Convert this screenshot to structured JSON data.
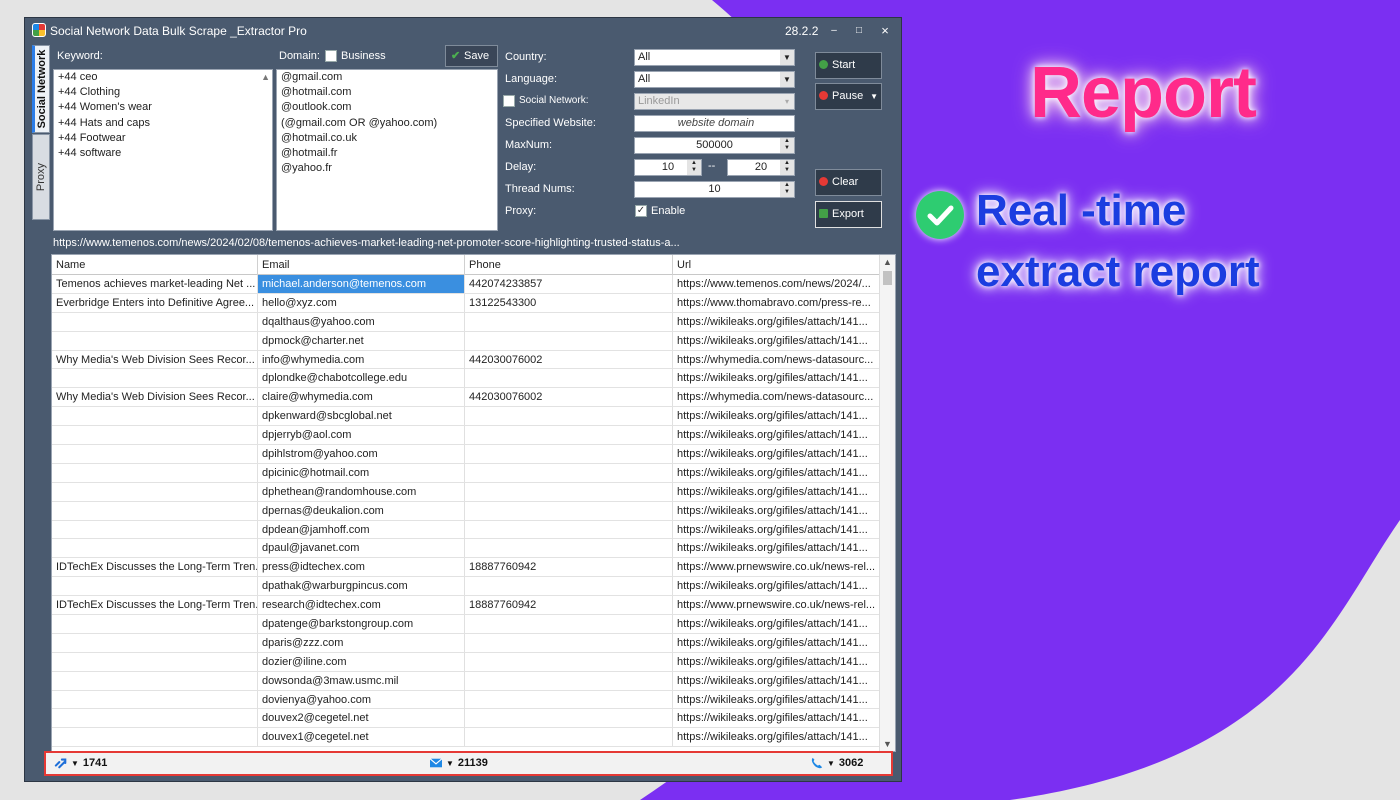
{
  "window": {
    "title": "Social Network Data Bulk Scrape _Extractor Pro",
    "version": "28.2.2",
    "controls": {
      "minimize": "–",
      "maximize": "□",
      "close": "×"
    }
  },
  "side_tabs": {
    "social_network": "Social Network",
    "proxy": "Proxy"
  },
  "keyword": {
    "label": "Keyword:",
    "items": [
      "+44 ceo",
      "+44  Clothing",
      "+44 Women's wear",
      "+44  Hats and caps",
      "+44 Footwear",
      "+44 software"
    ]
  },
  "domain": {
    "label": "Domain:",
    "business_label": "Business",
    "business_checked": false,
    "save_label": "Save",
    "items": [
      "@gmail.com",
      "@hotmail.com",
      "@outlook.com",
      "(@gmail.com OR @yahoo.com)",
      "@hotmail.co.uk",
      "@hotmail.fr",
      "@yahoo.fr"
    ]
  },
  "settings": {
    "country_label": "Country:",
    "country_value": "All",
    "language_label": "Language:",
    "language_value": "All",
    "social_network_label": "Social Network:",
    "social_network_checked": false,
    "social_network_value": "LinkedIn",
    "website_label": "Specified Website:",
    "website_placeholder": "website domain",
    "maxnum_label": "MaxNum:",
    "maxnum_value": "500000",
    "delay_label": "Delay:",
    "delay_min": "10",
    "delay_sep": "--",
    "delay_max": "20",
    "thread_label": "Thread Nums:",
    "thread_value": "10",
    "proxy_label": "Proxy:",
    "proxy_enable_label": "Enable",
    "proxy_enabled": true
  },
  "actions": {
    "start": "Start",
    "pause": "Pause",
    "clear": "Clear",
    "export": "Export"
  },
  "current_url": "https://www.temenos.com/news/2024/02/08/temenos-achieves-market-leading-net-promoter-score-highlighting-trusted-status-a...",
  "table": {
    "columns": [
      "Name",
      "Email",
      "Phone",
      "Url"
    ],
    "rows": [
      [
        "Temenos achieves market-leading Net ...",
        "michael.anderson@temenos.com",
        "442074233857",
        "https://www.temenos.com/news/2024/..."
      ],
      [
        "Everbridge Enters into Definitive Agree...",
        "hello@xyz.com",
        "13122543300",
        "https://www.thomabravo.com/press-re..."
      ],
      [
        "",
        "dqalthaus@yahoo.com",
        "",
        "https://wikileaks.org/gifiles/attach/141..."
      ],
      [
        "",
        "dpmock@charter.net",
        "",
        "https://wikileaks.org/gifiles/attach/141..."
      ],
      [
        "Why Media's Web Division Sees Recor...",
        "info@whymedia.com",
        "442030076002",
        "https://whymedia.com/news-datasourc..."
      ],
      [
        "",
        "dplondke@chabotcollege.edu",
        "",
        "https://wikileaks.org/gifiles/attach/141..."
      ],
      [
        "Why Media's Web Division Sees Recor...",
        "claire@whymedia.com",
        "442030076002",
        "https://whymedia.com/news-datasourc..."
      ],
      [
        "",
        "dpkenward@sbcglobal.net",
        "",
        "https://wikileaks.org/gifiles/attach/141..."
      ],
      [
        "",
        "dpjerryb@aol.com",
        "",
        "https://wikileaks.org/gifiles/attach/141..."
      ],
      [
        "",
        "dpihlstrom@yahoo.com",
        "",
        "https://wikileaks.org/gifiles/attach/141..."
      ],
      [
        "",
        "dpicinic@hotmail.com",
        "",
        "https://wikileaks.org/gifiles/attach/141..."
      ],
      [
        "",
        "dphethean@randomhouse.com",
        "",
        "https://wikileaks.org/gifiles/attach/141..."
      ],
      [
        "",
        "dpernas@deukalion.com",
        "",
        "https://wikileaks.org/gifiles/attach/141..."
      ],
      [
        "",
        "dpdean@jamhoff.com",
        "",
        "https://wikileaks.org/gifiles/attach/141..."
      ],
      [
        "",
        "dpaul@javanet.com",
        "",
        "https://wikileaks.org/gifiles/attach/141..."
      ],
      [
        "IDTechEx Discusses the Long-Term Tren...",
        "press@idtechex.com",
        "18887760942",
        "https://www.prnewswire.co.uk/news-rel..."
      ],
      [
        "",
        "dpathak@warburgpincus.com",
        "",
        "https://wikileaks.org/gifiles/attach/141..."
      ],
      [
        "IDTechEx Discusses the Long-Term Tren...",
        "research@idtechex.com",
        "18887760942",
        "https://www.prnewswire.co.uk/news-rel..."
      ],
      [
        "",
        "dpatenge@barkstongroup.com",
        "",
        "https://wikileaks.org/gifiles/attach/141..."
      ],
      [
        "",
        "dparis@zzz.com",
        "",
        "https://wikileaks.org/gifiles/attach/141..."
      ],
      [
        "",
        "dozier@iline.com",
        "",
        "https://wikileaks.org/gifiles/attach/141..."
      ],
      [
        "",
        "dowsonda@3maw.usmc.mil",
        "",
        "https://wikileaks.org/gifiles/attach/141..."
      ],
      [
        "",
        "dovienya@yahoo.com",
        "",
        "https://wikileaks.org/gifiles/attach/141..."
      ],
      [
        "",
        "douvex2@cegetel.net",
        "",
        "https://wikileaks.org/gifiles/attach/141..."
      ],
      [
        "",
        "douvex1@cegetel.net",
        "",
        "https://wikileaks.org/gifiles/attach/141..."
      ]
    ]
  },
  "status": {
    "urls": "1741",
    "emails": "21139",
    "phones": "3062"
  },
  "promo": {
    "title": "Report",
    "text": "Real -time extract report"
  },
  "colors": {
    "window_bg": "#4a5a6f",
    "accent_blue": "#3a8fe0",
    "highlight_border": "#e53935",
    "promo_purple": "#7b2ff2",
    "promo_pink": "#ff2a8a",
    "promo_blue": "#1b3de0",
    "check_green": "#2ecc71"
  },
  "icons": [
    "app-logo-icon",
    "link-icon",
    "email-icon",
    "phone-icon",
    "checkmark-icon",
    "play-icon",
    "pause-icon",
    "clear-icon",
    "export-icon"
  ]
}
